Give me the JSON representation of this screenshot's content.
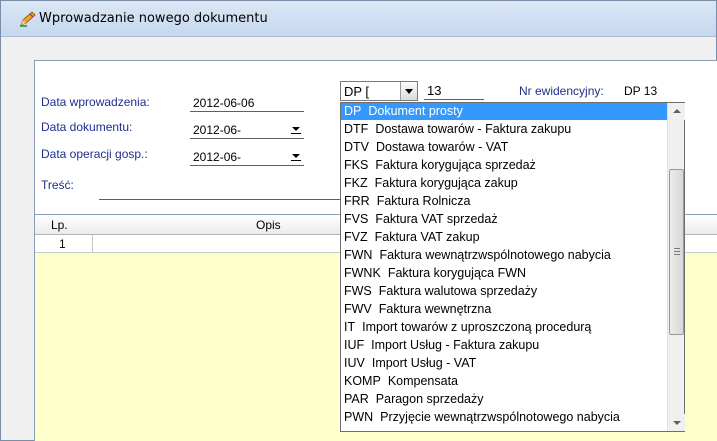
{
  "window": {
    "title": "Wprowadzanie nowego dokumentu"
  },
  "form": {
    "data_wprowadzenia_label": "Data wprowadzenia:",
    "data_wprowadzenia_value": "2012-06-06",
    "data_dokumentu_label": "Data dokumentu:",
    "data_dokumentu_value": "2012-06-",
    "data_operacji_label": "Data operacji gosp.:",
    "data_operacji_value": "2012-06-",
    "tresc_label": "Treść:",
    "doc_type_value": "DP  [",
    "doc_number": "13",
    "nr_ewidencyjny_label": "Nr ewidencyjny:",
    "nr_ewidencyjny_value": "DP   13"
  },
  "grid": {
    "col_lp": "Lp.",
    "col_opis": "Opis",
    "row1_lp": "1"
  },
  "dropdown": {
    "selected_index": 0,
    "items": [
      {
        "code": "DP",
        "name": "Dokument prosty"
      },
      {
        "code": "DTF",
        "name": "Dostawa towarów - Faktura zakupu"
      },
      {
        "code": "DTV",
        "name": "Dostawa towarów - VAT"
      },
      {
        "code": "FKS",
        "name": "Faktura korygująca sprzedaż"
      },
      {
        "code": "FKZ",
        "name": "Faktura korygująca zakup"
      },
      {
        "code": "FRR",
        "name": "Faktura Rolnicza"
      },
      {
        "code": "FVS",
        "name": "Faktura VAT sprzedaż"
      },
      {
        "code": "FVZ",
        "name": "Faktura VAT zakup"
      },
      {
        "code": "FWN",
        "name": "Faktura wewnątrzwspólnotowego nabycia"
      },
      {
        "code": "FWNK",
        "name": "Faktura korygująca FWN"
      },
      {
        "code": "FWS",
        "name": "Faktura walutowa sprzedaży"
      },
      {
        "code": "FWV",
        "name": "Faktura wewnętrzna"
      },
      {
        "code": "IT",
        "name": "Import towarów z uproszczoną procedurą"
      },
      {
        "code": "IUF",
        "name": "Import Usług - Faktura zakupu"
      },
      {
        "code": "IUV",
        "name": "Import Usług - VAT"
      },
      {
        "code": "KOMP",
        "name": "Kompensata"
      },
      {
        "code": "PAR",
        "name": "Paragon sprzedaży"
      },
      {
        "code": "PWN",
        "name": "Przyjęcie wewnątrzwspólnotowego nabycia"
      }
    ]
  },
  "colors": {
    "label_blue": "#1f2f8f",
    "selection": "#3399ff",
    "grid_bg": "#ffffcc"
  },
  "icons": {
    "title": "pencil-icon"
  }
}
